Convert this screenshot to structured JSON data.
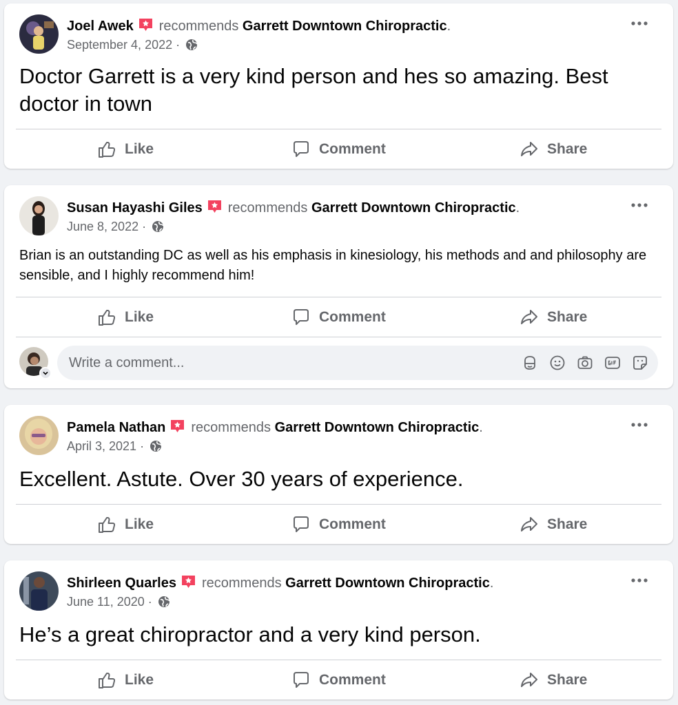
{
  "posts": [
    {
      "author": "Joel Awek",
      "recommends_text": "recommends",
      "page_name": "Garrett Downtown Chiropractic",
      "period": ".",
      "date": "September 4, 2022",
      "separator": " · ",
      "body": "Doctor Garrett is a very kind person and hes so amazing. Best doctor in town",
      "actions": {
        "like": "Like",
        "comment": "Comment",
        "share": "Share"
      }
    },
    {
      "author": "Susan Hayashi Giles",
      "recommends_text": "recommends",
      "page_name": "Garrett Downtown Chiropractic",
      "period": ".",
      "date": "June 8, 2022",
      "separator": " · ",
      "body": "Brian is an outstanding DC as well as his emphasis in kinesiology, his methods and and philosophy are sensible, and I highly recommend him!",
      "actions": {
        "like": "Like",
        "comment": "Comment",
        "share": "Share"
      },
      "comment_box": {
        "placeholder": "Write a comment..."
      }
    },
    {
      "author": "Pamela Nathan",
      "recommends_text": "recommends",
      "page_name": "Garrett Downtown Chiropractic",
      "period": ".",
      "date": "April 3, 2021",
      "separator": " · ",
      "body": "Excellent. Astute. Over 30 years of experience.",
      "actions": {
        "like": "Like",
        "comment": "Comment",
        "share": "Share"
      }
    },
    {
      "author": "Shirleen Quarles",
      "recommends_text": "recommends",
      "page_name": "Garrett Downtown Chiropractic",
      "period": ".",
      "date": "June 11, 2020",
      "separator": " · ",
      "body": "He’s a great chiropractor and a very kind person.",
      "actions": {
        "like": "Like",
        "comment": "Comment",
        "share": "Share"
      }
    }
  ],
  "icons": {
    "recommend_badge": "recommend-star-icon",
    "audience": "globe-icon",
    "more": "more-dots-icon",
    "like": "thumbs-up-icon",
    "comment": "comment-bubble-icon",
    "share": "share-arrow-icon",
    "comment_tools": [
      "avatar-sticker-icon",
      "emoji-icon",
      "camera-icon",
      "gif-icon",
      "sticker-icon"
    ]
  },
  "colors": {
    "background": "#f0f2f5",
    "card": "#ffffff",
    "primary_text": "#050505",
    "secondary_text": "#65676b",
    "recommend_badge": "#f3425f",
    "divider": "#ced0d4"
  }
}
